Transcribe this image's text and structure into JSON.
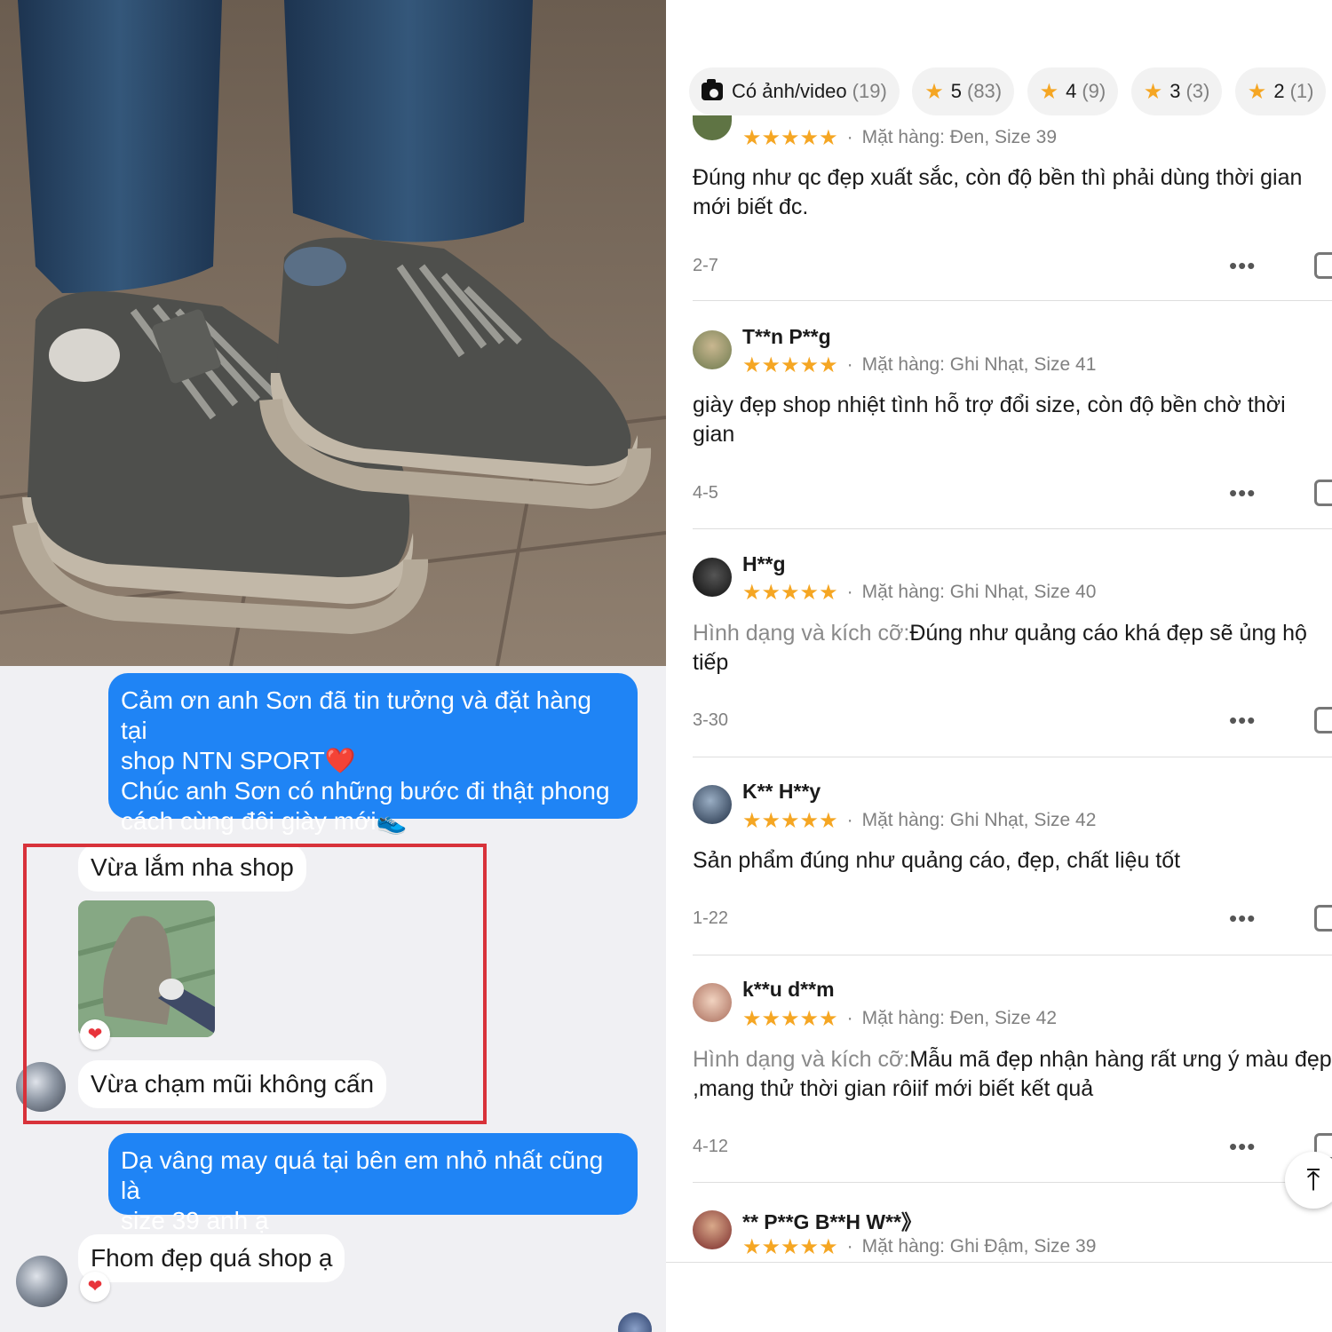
{
  "chat": {
    "msg1": "Cảm ơn anh Sơn đã tin tưởng và đặt hàng tại\nshop NTN SPORT❤️\nChúc anh Sơn có những bước đi thật phong\ncách cùng đôi giày mới👟",
    "msg2": "Vừa lắm nha shop",
    "msg3": "Vừa chạm mũi không cấn",
    "msg4": "Dạ vâng may quá tại bên em nhỏ nhất cũng là\nsize 39 anh ạ",
    "msg5": "Fhom đẹp quá shop ạ",
    "reaction": "❤"
  },
  "filters": {
    "media": {
      "label": "Có ảnh/video",
      "count": "(19)"
    },
    "ratings": [
      {
        "label": "5",
        "count": "(83)"
      },
      {
        "label": "4",
        "count": "(9)"
      },
      {
        "label": "3",
        "count": "(3)"
      },
      {
        "label": "2",
        "count": "(1)"
      }
    ]
  },
  "stars": "★★★★★",
  "reviews": [
    {
      "name": "",
      "variant": "Mặt hàng: Đen, Size 39",
      "label": "",
      "text": "Đúng như qc đẹp xuất sắc, còn độ bền thì phải dùng thời gian mới biết đc.",
      "date": "2-7"
    },
    {
      "name": "T**n P**g",
      "variant": "Mặt hàng: Ghi Nhạt, Size 41",
      "label": "",
      "text": "giày đẹp shop nhiệt tình hỗ trợ đổi size, còn độ bền chờ thời gian",
      "date": "4-5"
    },
    {
      "name": "H**g",
      "variant": "Mặt hàng: Ghi Nhạt, Size 40",
      "label": "Hình dạng và kích cỡ:",
      "text": "Đúng như quảng cáo khá đẹp sẽ ủng hộ tiếp",
      "date": "3-30"
    },
    {
      "name": "K** H**y",
      "variant": "Mặt hàng: Ghi Nhạt, Size 42",
      "label": "",
      "text": "Sản phẩm đúng như quảng cáo, đẹp, chất liệu tốt",
      "date": "1-22"
    },
    {
      "name": "k**u d**m",
      "variant": "Mặt hàng: Đen, Size 42",
      "label": "Hình dạng và kích cỡ:",
      "text": "Mẫu mã đẹp nhận hàng rất ưng ý màu đẹp ,mang thử thời gian rôiif mới biết kết quả",
      "date": "4-12"
    },
    {
      "name": "** P**G B**H W**》",
      "variant": "Mặt hàng: Ghi Đậm, Size 39",
      "label": "",
      "text": "",
      "date": ""
    }
  ],
  "icons": {
    "more": "•••",
    "scroll_top": "⤒"
  }
}
